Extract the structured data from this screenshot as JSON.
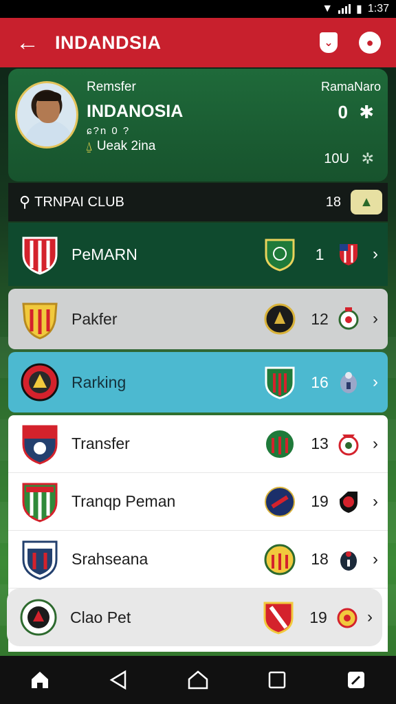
{
  "status_bar": {
    "time": "1:37"
  },
  "app_bar": {
    "back_icon": "arrow-left-icon",
    "title": "INDANDSIA",
    "actions": [
      "shield-icon",
      "profile-icon"
    ]
  },
  "profile": {
    "subtitle": "Remsfer",
    "name": "INDANOSIA",
    "meta": "ɕ?n 0 ?",
    "note": "Ueak 2ina",
    "right_label": "RamaNaro",
    "right_value": "0",
    "right_value_2": "10U"
  },
  "search": {
    "label": "TRNPAI CLUB",
    "count": "18",
    "button_icon": "triangle-icon"
  },
  "rows": [
    {
      "label": "PeMARN",
      "number": "1",
      "style": "dark"
    },
    {
      "label": "Pakfer",
      "number": "12",
      "style": "gray"
    },
    {
      "label": "Rarking",
      "number": "16",
      "style": "cyan"
    },
    {
      "label": "Transfer",
      "number": "13",
      "style": "white"
    },
    {
      "label": "Tranqp Peman",
      "number": "19",
      "style": "white"
    },
    {
      "label": "Srahseana",
      "number": "18",
      "style": "white"
    },
    {
      "label": "Clao Pet",
      "number": "19",
      "style": "white-selected"
    }
  ],
  "nav_bar": {
    "icons": [
      "home-icon",
      "back-icon",
      "home-circle-icon",
      "recents-icon",
      "edit-icon"
    ]
  },
  "colors": {
    "primary": "#c8202d",
    "profile_green": "#1f6a3a",
    "highlight_cyan": "#4cb9d0",
    "row_gray": "#cfd1d1",
    "dark_green": "#0f4a2e"
  }
}
